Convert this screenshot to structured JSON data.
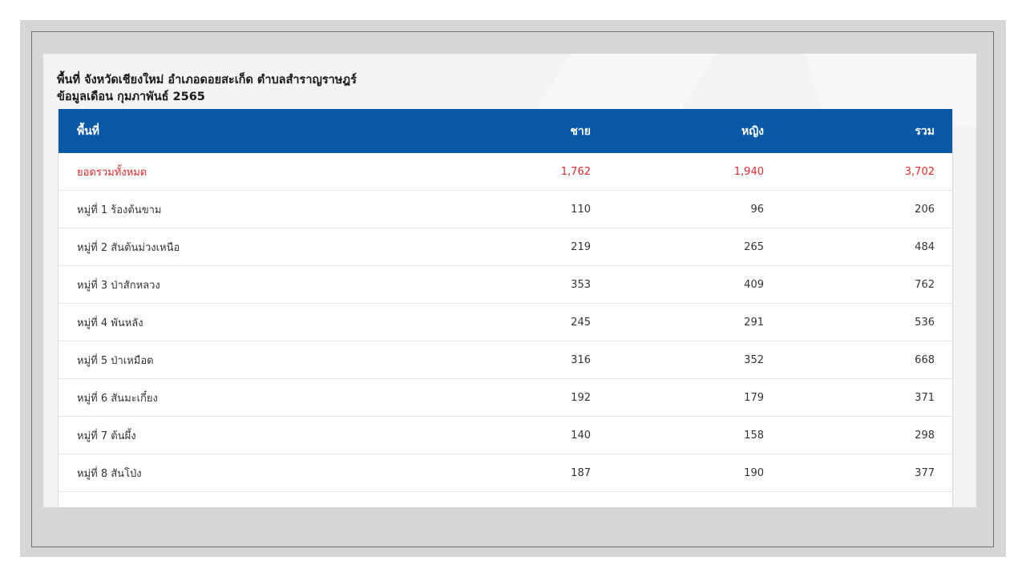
{
  "header": {
    "line1": "พื้นที่ จังหวัดเชียงใหม่ อำเภอดอยสะเก็ด ตำบลสำราญราษฎร์",
    "line2": "ข้อมูลเดือน กุมภาพันธ์ 2565"
  },
  "table": {
    "columns": [
      "พื้นที่",
      "ชาย",
      "หญิง",
      "รวม"
    ],
    "total": {
      "label": "ยอดรวมทั้งหมด",
      "male": "1,762",
      "female": "1,940",
      "sum": "3,702"
    },
    "rows": [
      {
        "label": "หมู่ที่ 1 ร้องต้นขาม",
        "male": "110",
        "female": "96",
        "sum": "206"
      },
      {
        "label": "หมู่ที่ 2 สันต้นม่วงเหนือ",
        "male": "219",
        "female": "265",
        "sum": "484"
      },
      {
        "label": "หมู่ที่ 3 ป่าสักหลวง",
        "male": "353",
        "female": "409",
        "sum": "762"
      },
      {
        "label": "หมู่ที่ 4 พันหลัง",
        "male": "245",
        "female": "291",
        "sum": "536"
      },
      {
        "label": "หมู่ที่ 5 ป่าเหมือด",
        "male": "316",
        "female": "352",
        "sum": "668"
      },
      {
        "label": "หมู่ที่ 6 สันมะเกี๋ยง",
        "male": "192",
        "female": "179",
        "sum": "371"
      },
      {
        "label": "หมู่ที่ 7 ต้นผึ้ง",
        "male": "140",
        "female": "158",
        "sum": "298"
      },
      {
        "label": "หมู่ที่ 8 สันโป่ง",
        "male": "187",
        "female": "190",
        "sum": "377"
      }
    ]
  },
  "colors": {
    "header_bg": "#0a59a6",
    "total_text": "#d92b2b",
    "background": "#d6d6d6"
  }
}
